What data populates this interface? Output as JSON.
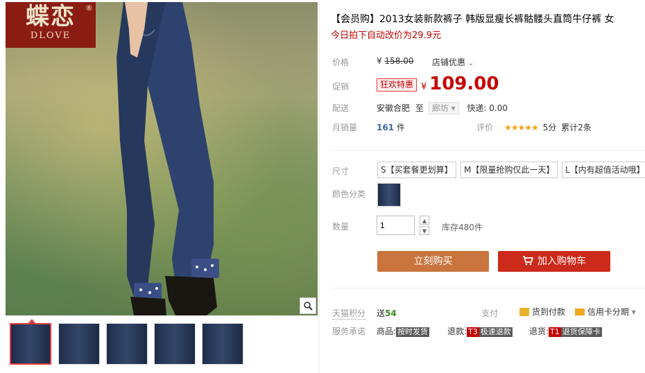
{
  "brand": {
    "name_cn": "蝶恋",
    "name_en": "DLOVE",
    "reg_mark": "®"
  },
  "icons": {
    "zoom": "search-icon",
    "cart": "cart-icon"
  },
  "gallery": {
    "thumb_count": 5,
    "active_thumb_index": 0
  },
  "product": {
    "title": "【会员购】2013女装新款裤子 韩版显瘦长裤骷髅头直筒牛仔裤 女",
    "subtitle": "今日拍下自动改价为29.9元"
  },
  "price": {
    "label": "价格",
    "currency": "¥",
    "original": "158.00",
    "shop_discount": "店铺优惠",
    "promo_label": "促销",
    "promo_tag": "狂欢特惠",
    "promo_currency": "¥",
    "promo_price": "109.00"
  },
  "delivery": {
    "label": "配送",
    "from": "安徽合肥",
    "to_word": "至",
    "to": "廊坊",
    "express": "快递: 0.00"
  },
  "sales": {
    "label": "月销量",
    "count": "161",
    "unit": "件",
    "rating_label": "评价",
    "stars": "★★★★★",
    "score": "5分",
    "review_count": "累计2条"
  },
  "sku": {
    "size_label": "尺寸",
    "sizes": [
      "S【买套餐更划算】",
      "M【限量抢购仅此一天】",
      "L【内有超值活动哦】"
    ],
    "color_label": "颜色分类",
    "qty_label": "数量",
    "qty_value": "1",
    "stock": "库存480件"
  },
  "actions": {
    "buy_now": "立刻购买",
    "add_to_cart": "加入购物车"
  },
  "footer": {
    "points_label": "天猫积分",
    "points_prefix": "送",
    "points_value": "54",
    "pay_label": "支付",
    "pay_cod": "货到付款",
    "pay_credit": "信用卡分期",
    "service_label": "服务承诺",
    "goods_label": "商品:",
    "goods_badge": "按时发货",
    "refund_label": "退款:",
    "refund_code": "T3",
    "refund_badge": "极速退款",
    "return_label": "退货:",
    "return_code": "T1",
    "return_badge": "退货保障卡"
  },
  "colors": {
    "accent_red": "#c40000",
    "buy_orange": "#c9753d",
    "cart_red": "#cc2a1a"
  }
}
